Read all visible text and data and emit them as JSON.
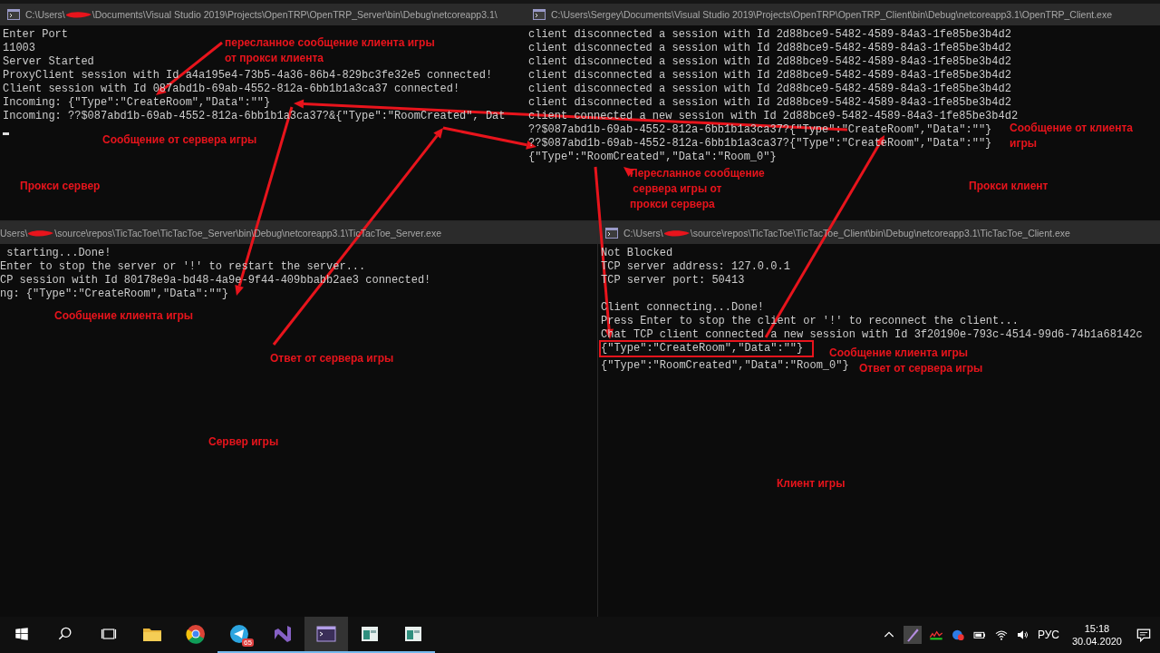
{
  "windows": [
    {
      "title": [
        "C:\\Users\\",
        "\\Documents\\Visual Studio 2019\\Projects\\OpenTRP\\OpenTRP_Server\\bin\\Debug\\netcoreapp3.1\\"
      ],
      "cursor": true,
      "blocks": [
        [
          "Enter Port",
          "11003",
          "Server Started",
          "ProxyClient session with Id a4a195e4-73b5-4a36-86b4-829bc3fe32e5 connected!",
          "Client session with Id 087abd1b-69ab-4552-812a-6bb1b1a3ca37 connected!",
          "Incoming: {\"Type\":\"CreateRoom\",\"Data\":\"\"}",
          "Incoming: ??$087abd1b-69ab-4552-812a-6bb1b1a3ca37?&{\"Type\":\"RoomCreated\", Dat"
        ]
      ]
    },
    {
      "title": [
        "C:\\Users\\Sergey\\Documents\\Visual Studio 2019\\Projects\\OpenTRP\\OpenTRP_Client\\bin\\Debug\\netcoreapp3.1\\OpenTRP_Client.exe"
      ],
      "cursor": false,
      "blocks": [
        [
          "client disconnected a session with Id 2d88bce9-5482-4589-84a3-1fe85be3b4d2",
          "client disconnected a session with Id 2d88bce9-5482-4589-84a3-1fe85be3b4d2",
          "client disconnected a session with Id 2d88bce9-5482-4589-84a3-1fe85be3b4d2",
          "client disconnected a session with Id 2d88bce9-5482-4589-84a3-1fe85be3b4d2",
          "client disconnected a session with Id 2d88bce9-5482-4589-84a3-1fe85be3b4d2",
          "client disconnected a session with Id 2d88bce9-5482-4589-84a3-1fe85be3b4d2",
          "client connected a new session with Id 2d88bce9-5482-4589-84a3-1fe85be3b4d2",
          "??$087abd1b-69ab-4552-812a-6bb1b1a3ca37?{\"Type\":\"CreateRoom\",\"Data\":\"\"}",
          "??$087abd1b-69ab-4552-812a-6bb1b1a3ca37?{\"Type\":\"CreateRoom\",\"Data\":\"\"}",
          "{\"Type\":\"RoomCreated\",\"Data\":\"Room_0\"}"
        ]
      ]
    },
    {
      "title": [
        "Users\\",
        "\\source\\repos\\TicTacToe\\TicTacToe_Server\\bin\\Debug\\netcoreapp3.1\\TicTacToe_Server.exe"
      ],
      "cursor": false,
      "blocks": [
        [
          " starting...Done!",
          "Enter to stop the server or '!' to restart the server...",
          "CP session with Id 80178e9a-bd48-4a9e-9f44-409bbabb2ae3 connected!",
          "ng: {\"Type\":\"CreateRoom\",\"Data\":\"\"}"
        ]
      ]
    },
    {
      "title": [
        "C:\\Users\\",
        "\\source\\repos\\TicTacToe\\TicTacToe_Client\\bin\\Debug\\netcoreapp3.1\\TicTacToe_Client.exe"
      ],
      "cursor": false,
      "blocks": [
        [
          "Not Blocked",
          "TCP server address: 127.0.0.1",
          "TCP server port: 50413"
        ],
        [
          "Client connecting...Done!",
          "Press Enter to stop the client or '!' to reconnect the client...",
          "Chat TCP client connected a new session with Id 3f20190e-793c-4514-99d6-74b1a68142c",
          {
            "text": "{\"Type\":\"CreateRoom\",\"Data\":\"\"}",
            "boxed": true
          },
          "{\"Type\":\"RoomCreated\",\"Data\":\"Room_0\"}"
        ]
      ]
    }
  ],
  "annotations": [
    {
      "text": "пересланное сообщение клиента игры\nот прокси клиента"
    },
    {
      "text": "Сообщение от сервера игры"
    },
    {
      "text": "Прокси сервер"
    },
    {
      "text": "Сообщение от клиента\nигры"
    },
    {
      "text": "Пересланное сообщение\n сервера игры от\nпрокси сервера"
    },
    {
      "text": "Прокси клиент"
    },
    {
      "text": "Сообщение клиента игры"
    },
    {
      "text": "Ответ от сервера игры"
    },
    {
      "text": "Сообщение клиента игры"
    },
    {
      "text": "Ответ от сервера игры"
    },
    {
      "text": "Сервер игры"
    },
    {
      "text": "Клиент игры"
    }
  ],
  "taskbar": {
    "apps": [
      {
        "kind": "folder",
        "running": false,
        "selected": false
      },
      {
        "kind": "browser",
        "running": false,
        "selected": false
      },
      {
        "kind": "messenger",
        "running": true,
        "selected": false,
        "badge": "65"
      },
      {
        "kind": "ide",
        "running": true,
        "selected": false
      },
      {
        "kind": "console",
        "running": true,
        "selected": true
      },
      {
        "kind": "app",
        "running": true,
        "selected": false
      },
      {
        "kind": "app",
        "running": true,
        "selected": false
      }
    ],
    "language": "РУС",
    "time": "15:18",
    "date": "30.04.2020"
  }
}
